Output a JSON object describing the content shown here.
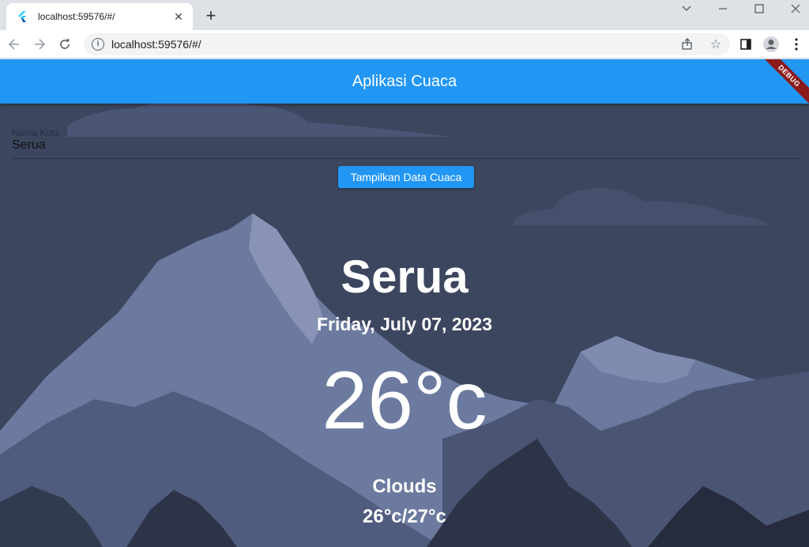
{
  "browser": {
    "tab_title": "localhost:59576/#/",
    "url": "localhost:59576/#/"
  },
  "app": {
    "title": "Aplikasi Cuaca",
    "debug_label": "DEBUG",
    "city_field": {
      "label": "Nama Kota",
      "value": "Serua"
    },
    "show_button_label": "Tampilkan Data Cuaca",
    "weather": {
      "city": "Serua",
      "date": "Friday, July 07, 2023",
      "temperature": "26°c",
      "condition": "Clouds",
      "min_max": "26°c/27°c"
    }
  },
  "colors": {
    "appbar": "#2196f3",
    "debug_banner": "#8b1a1a",
    "sky": "#3d465f",
    "mountain_light": "#7583a8",
    "mountain_mid": "#4d5878",
    "mountain_dark": "#262c3d"
  }
}
